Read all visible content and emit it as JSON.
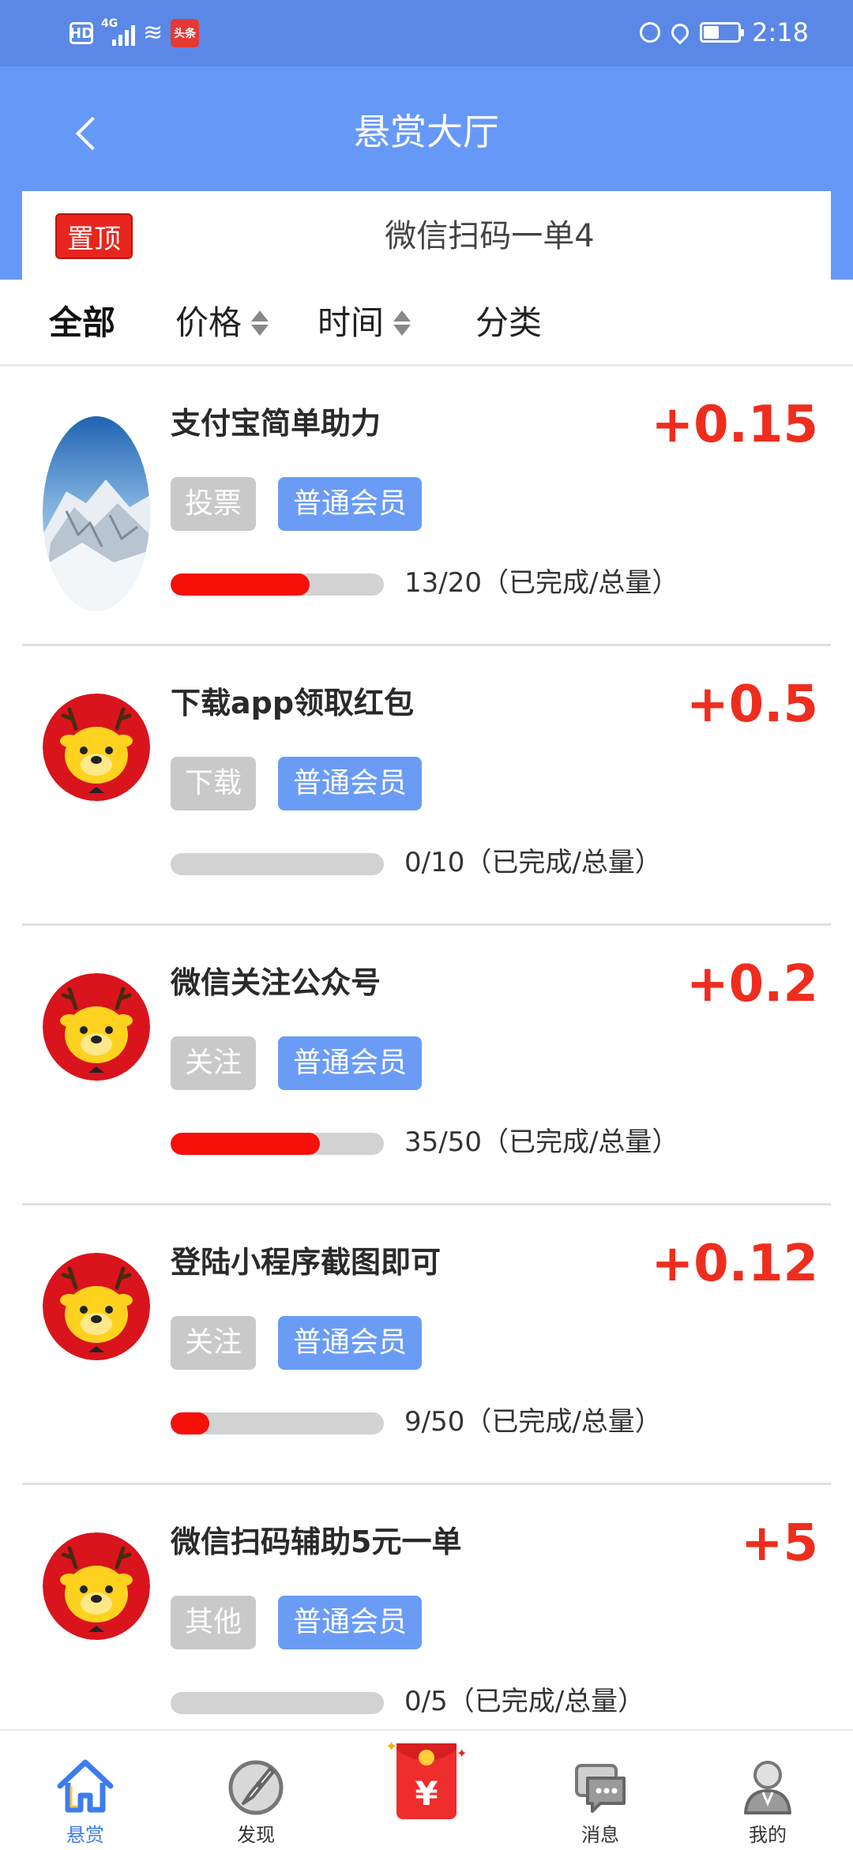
{
  "status_bar": {
    "network_badge": "HD",
    "signal_type": "4G",
    "app_badge": "头条",
    "time": "2:18"
  },
  "header": {
    "title": "悬赏大厅",
    "pinned": {
      "badge": "置顶",
      "text": "微信扫码一单4"
    }
  },
  "filters": [
    {
      "label": "全部",
      "active": true
    },
    {
      "label": "价格",
      "sortable": true
    },
    {
      "label": "时间",
      "sortable": true
    },
    {
      "label": "分类"
    }
  ],
  "tasks": [
    {
      "title": "支付宝简单助力",
      "reward": "+0.15",
      "type_tag": "投票",
      "member_tag": "普通会员",
      "progress_text": "13/20（已完成/总量）",
      "progress": 0.65,
      "avatar": "snow-mountain-photo"
    },
    {
      "title": "下载app领取红包",
      "reward": "+0.5",
      "type_tag": "下载",
      "member_tag": "普通会员",
      "progress_text": "0/10（已完成/总量）",
      "progress": 0.0,
      "avatar": "deer-mascot"
    },
    {
      "title": "微信关注公众号",
      "reward": "+0.2",
      "type_tag": "关注",
      "member_tag": "普通会员",
      "progress_text": "35/50（已完成/总量）",
      "progress": 0.7,
      "avatar": "deer-mascot"
    },
    {
      "title": "登陆小程序截图即可",
      "reward": "+0.12",
      "type_tag": "关注",
      "member_tag": "普通会员",
      "progress_text": "9/50（已完成/总量）",
      "progress": 0.18,
      "avatar": "deer-mascot"
    },
    {
      "title": "微信扫码辅助5元一单",
      "reward": "+5",
      "type_tag": "其他",
      "member_tag": "普通会员",
      "progress_text": "0/5（已完成/总量）",
      "progress": 0.0,
      "avatar": "deer-mascot"
    }
  ],
  "bottom_nav": [
    {
      "label": "悬赏",
      "icon": "home-icon",
      "active": true
    },
    {
      "label": "发现",
      "icon": "compass-icon"
    },
    {
      "label": "",
      "icon": "red-envelope-icon"
    },
    {
      "label": "消息",
      "icon": "message-icon"
    },
    {
      "label": "我的",
      "icon": "profile-icon"
    }
  ],
  "colors": {
    "header_blue": "#6699f7",
    "reward_red": "#ef2d1e",
    "progress_red": "#f5100a",
    "member_tag_blue": "#6b9cf5",
    "active_nav_blue": "#3d7cf0"
  }
}
